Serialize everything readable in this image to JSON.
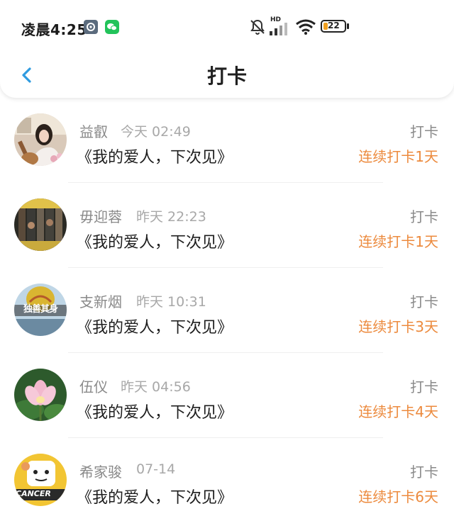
{
  "status_bar": {
    "time": "凌晨4:25",
    "battery": "22",
    "network_label": "HD"
  },
  "nav": {
    "title": "打卡"
  },
  "colors": {
    "accent": "#2f9be0",
    "streak": "#ec8a3d"
  },
  "items": [
    {
      "name": "益叡",
      "time": "今天 02:49",
      "title": "《我的爱人，下次见》",
      "action": "打卡",
      "streak": "连续打卡1天",
      "avatar_icon": "girl-guitar-avatar"
    },
    {
      "name": "毋迎蓉",
      "time": "昨天 22:23",
      "title": "《我的爱人，下次见》",
      "action": "打卡",
      "streak": "连续打卡1天",
      "avatar_icon": "poster-avatar"
    },
    {
      "name": "支新烟",
      "time": "昨天 10:31",
      "title": "《我的爱人，下次见》",
      "action": "打卡",
      "streak": "连续打卡3天",
      "avatar_icon": "balloon-avatar",
      "avatar_text": "独善其身"
    },
    {
      "name": "伍仪",
      "time": "昨天 04:56",
      "title": "《我的爱人，下次见》",
      "action": "打卡",
      "streak": "连续打卡4天",
      "avatar_icon": "lotus-avatar"
    },
    {
      "name": "希家骏",
      "time": "07-14",
      "title": "《我的爱人，下次见》",
      "action": "打卡",
      "streak": "连续打卡6天",
      "avatar_icon": "cancer-cartoon-avatar",
      "avatar_text": "CANCER"
    }
  ]
}
